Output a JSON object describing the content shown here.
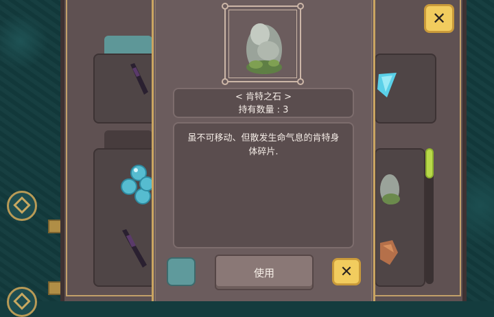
{
  "item": {
    "name": "< 肯特之石 >",
    "quantity_label": "持有数量 : 3",
    "description": "虽不可移动、但散发生命气息的肯特身体碎片."
  },
  "buttons": {
    "use_label": "使用",
    "close_symbol": "✕"
  },
  "icons": {
    "item_image": "stone-statue-icon",
    "bg_items": [
      "dark-spear-icon",
      "blue-crystal-icon",
      "water-bubbles-icon",
      "stone-statue-icon",
      "copper-ore-icon"
    ]
  },
  "colors": {
    "close_button": "#f2cc5e",
    "scroll_thumb": "#b8d84a",
    "slot": "#5f9a9c"
  }
}
